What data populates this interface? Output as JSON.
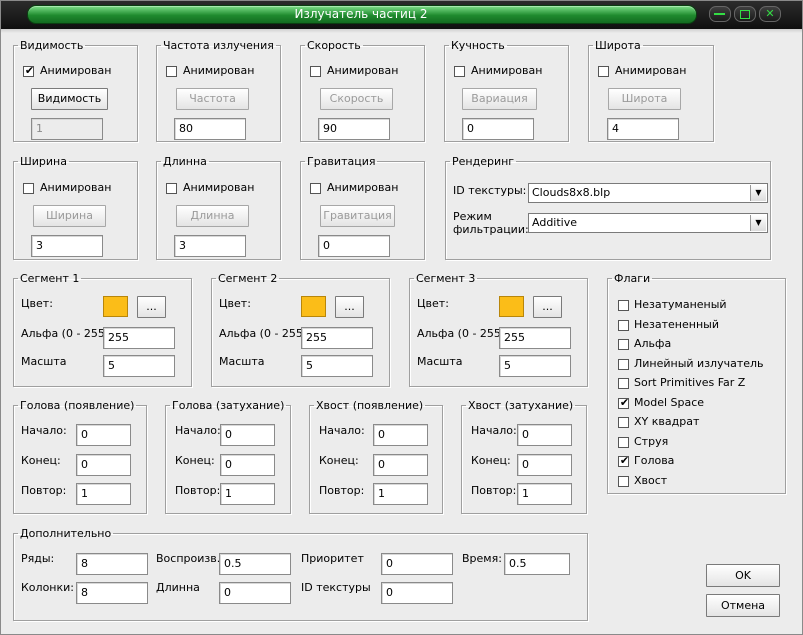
{
  "window": {
    "title": "Излучатель частиц 2"
  },
  "common": {
    "animated": "Анимирован"
  },
  "groups_top": [
    {
      "title": "Видимость",
      "button": "Видимость",
      "button_disabled": false,
      "checked": true,
      "value": "1",
      "value_disabled": true
    },
    {
      "title": "Частота излучения",
      "button": "Частота",
      "button_disabled": true,
      "checked": false,
      "value": "80",
      "value_disabled": false
    },
    {
      "title": "Скорость",
      "button": "Скорость",
      "button_disabled": true,
      "checked": false,
      "value": "90",
      "value_disabled": false
    },
    {
      "title": "Кучность",
      "button": "Вариация",
      "button_disabled": true,
      "checked": false,
      "value": "0",
      "value_disabled": false
    },
    {
      "title": "Широта",
      "button": "Широта",
      "button_disabled": true,
      "checked": false,
      "value": "4",
      "value_disabled": false
    }
  ],
  "groups_mid": [
    {
      "title": "Ширина",
      "button": "Ширина",
      "checked": false,
      "value": "3"
    },
    {
      "title": "Длинна",
      "button": "Длинна",
      "checked": false,
      "value": "3"
    },
    {
      "title": "Гравитация",
      "button": "Гравитация",
      "checked": false,
      "value": "0"
    }
  ],
  "rendering": {
    "title": "Рендеринг",
    "texture_label": "ID текстуры:",
    "texture_value": "Clouds8x8.blp",
    "filter_label_1": "Режим",
    "filter_label_2": "фильтрации:",
    "filter_value": "Additive"
  },
  "segments": [
    {
      "title": "Сегмент 1",
      "color_label": "Цвет:",
      "color": "#fbbd18",
      "dots": "...",
      "alpha_label": "Альфа (0 - 255)",
      "alpha": "255",
      "scale_label": "Масшта",
      "scale": "5"
    },
    {
      "title": "Сегмент 2",
      "color_label": "Цвет:",
      "color": "#fbbd18",
      "dots": "...",
      "alpha_label": "Альфа (0 - 255)",
      "alpha": "255",
      "scale_label": "Масшта",
      "scale": "5"
    },
    {
      "title": "Сегмент 3",
      "color_label": "Цвет:",
      "color": "#fbbd18",
      "dots": "...",
      "alpha_label": "Альфа (0 - 255)",
      "alpha": "255",
      "scale_label": "Масшта",
      "scale": "5"
    }
  ],
  "flags": {
    "title": "Флаги",
    "items": [
      {
        "label": "Незатуманеный",
        "checked": false
      },
      {
        "label": "Незатененный",
        "checked": false
      },
      {
        "label": "Альфа",
        "checked": false
      },
      {
        "label": "Линейный излучатель",
        "checked": false
      },
      {
        "label": "Sort Primitives Far Z",
        "checked": false
      },
      {
        "label": "Model Space",
        "checked": true
      },
      {
        "label": "XY квадрат",
        "checked": false
      },
      {
        "label": "Струя",
        "checked": false
      },
      {
        "label": "Голова",
        "checked": true
      },
      {
        "label": "Хвост",
        "checked": false
      }
    ]
  },
  "ranges": [
    {
      "title": "Голова (появление)",
      "start_label": "Начало:",
      "start": "0",
      "end_label": "Конец:",
      "end": "0",
      "repeat_label": "Повтор:",
      "repeat": "1"
    },
    {
      "title": "Голова (затухание)",
      "start_label": "Начало:",
      "start": "0",
      "end_label": "Конец:",
      "end": "0",
      "repeat_label": "Повтор:",
      "repeat": "1"
    },
    {
      "title": "Хвост (появление)",
      "start_label": "Начало:",
      "start": "0",
      "end_label": "Конец:",
      "end": "0",
      "repeat_label": "Повтор:",
      "repeat": "1"
    },
    {
      "title": "Хвост (затухание)",
      "start_label": "Начало:",
      "start": "0",
      "end_label": "Конец:",
      "end": "0",
      "repeat_label": "Повтор:",
      "repeat": "1"
    }
  ],
  "extra": {
    "title": "Дополнительно",
    "rows_label": "Ряды:",
    "rows": "8",
    "cols_label": "Колонки:",
    "cols": "8",
    "play_label": "Воспроизв.",
    "play": "0.5",
    "length_label": "Длинна",
    "length": "0",
    "priority_label": "Приоритет",
    "priority": "0",
    "texid_label": "ID текстуры",
    "texid": "0",
    "time_label": "Время:",
    "time": "0.5"
  },
  "buttons": {
    "ok": "OK",
    "cancel": "Отмена"
  }
}
